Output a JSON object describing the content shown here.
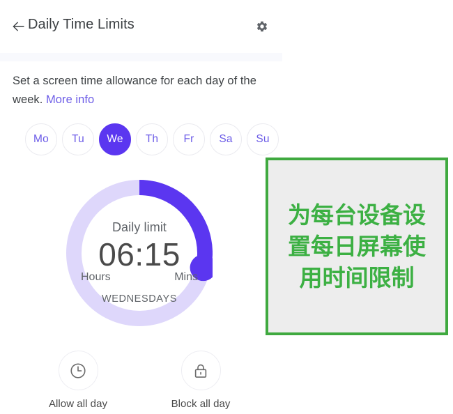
{
  "header": {
    "title": "Daily Time Limits",
    "back_icon": "arrow-left-icon",
    "settings_icon": "gear-icon"
  },
  "description": {
    "text": "Set a screen time allowance for each day of the week. ",
    "link_label": "More info"
  },
  "day_selector": {
    "days": [
      {
        "label": "Mo",
        "selected": false
      },
      {
        "label": "Tu",
        "selected": false
      },
      {
        "label": "We",
        "selected": true
      },
      {
        "label": "Th",
        "selected": false
      },
      {
        "label": "Fr",
        "selected": false
      },
      {
        "label": "Sa",
        "selected": false
      },
      {
        "label": "Su",
        "selected": false
      }
    ]
  },
  "dial": {
    "label": "Daily limit",
    "time": "06:15",
    "hours_label": "Hours",
    "mins_label": "Mins",
    "day_label": "WEDNESDAYS",
    "hours_value": 6,
    "mins_value": 15,
    "progress_degrees": 103,
    "track_color": "#ded7fb",
    "progress_color": "#5b36f0",
    "knob_color": "#5b36f0"
  },
  "actions": {
    "allow": {
      "label": "Allow all day",
      "icon": "clock-icon"
    },
    "block": {
      "label": "Block all day",
      "icon": "lock-icon"
    }
  },
  "annotation": {
    "text": "为每台设备设置每日屏幕使用时间限制",
    "text_color": "#3cb043",
    "border_color": "#3fa93f",
    "background_color": "#ededed"
  }
}
